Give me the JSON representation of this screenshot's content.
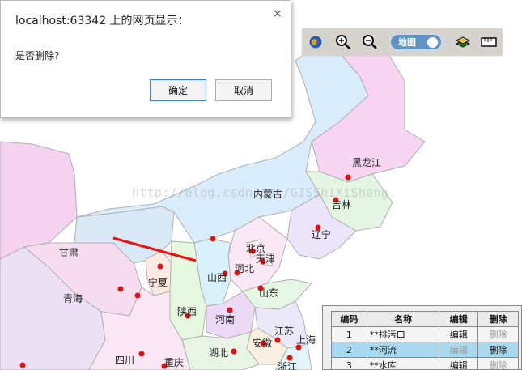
{
  "dialog": {
    "title": "localhost:63342 上的网页显示：",
    "close_glyph": "×",
    "message": "是否删除?",
    "ok_label": "确定",
    "cancel_label": "取消"
  },
  "toolbar": {
    "map_toggle_label": "地图",
    "icons": [
      "globe-icon",
      "zoom-in-icon",
      "zoom-out-icon",
      "layers-icon",
      "ruler-icon"
    ]
  },
  "watermark": "http://blog.csdn.net/GISShiXiSheng",
  "map": {
    "provinces": [
      "黑龙江",
      "吉林",
      "内蒙古",
      "辽宁",
      "北京",
      "天津",
      "甘肃",
      "宁夏",
      "河北",
      "山西",
      "青海",
      "山东",
      "陕西",
      "河南",
      "江苏",
      "上海",
      "安徽",
      "湖北",
      "四川",
      "重庆",
      "浙江"
    ],
    "colors": {
      "red_marker": "#e01010",
      "route_line": "#ee1111"
    }
  },
  "table": {
    "headers": [
      "编码",
      "名称",
      "编辑",
      "删除"
    ],
    "rows": [
      {
        "id": "1",
        "name": "**排污口",
        "edit": "编辑",
        "delete": "删除",
        "selected": false
      },
      {
        "id": "2",
        "name": "**河流",
        "edit": "编辑",
        "delete": "删除",
        "selected": true
      },
      {
        "id": "3",
        "name": "**水库",
        "edit": "编辑",
        "delete": "删除",
        "selected": false
      }
    ]
  }
}
